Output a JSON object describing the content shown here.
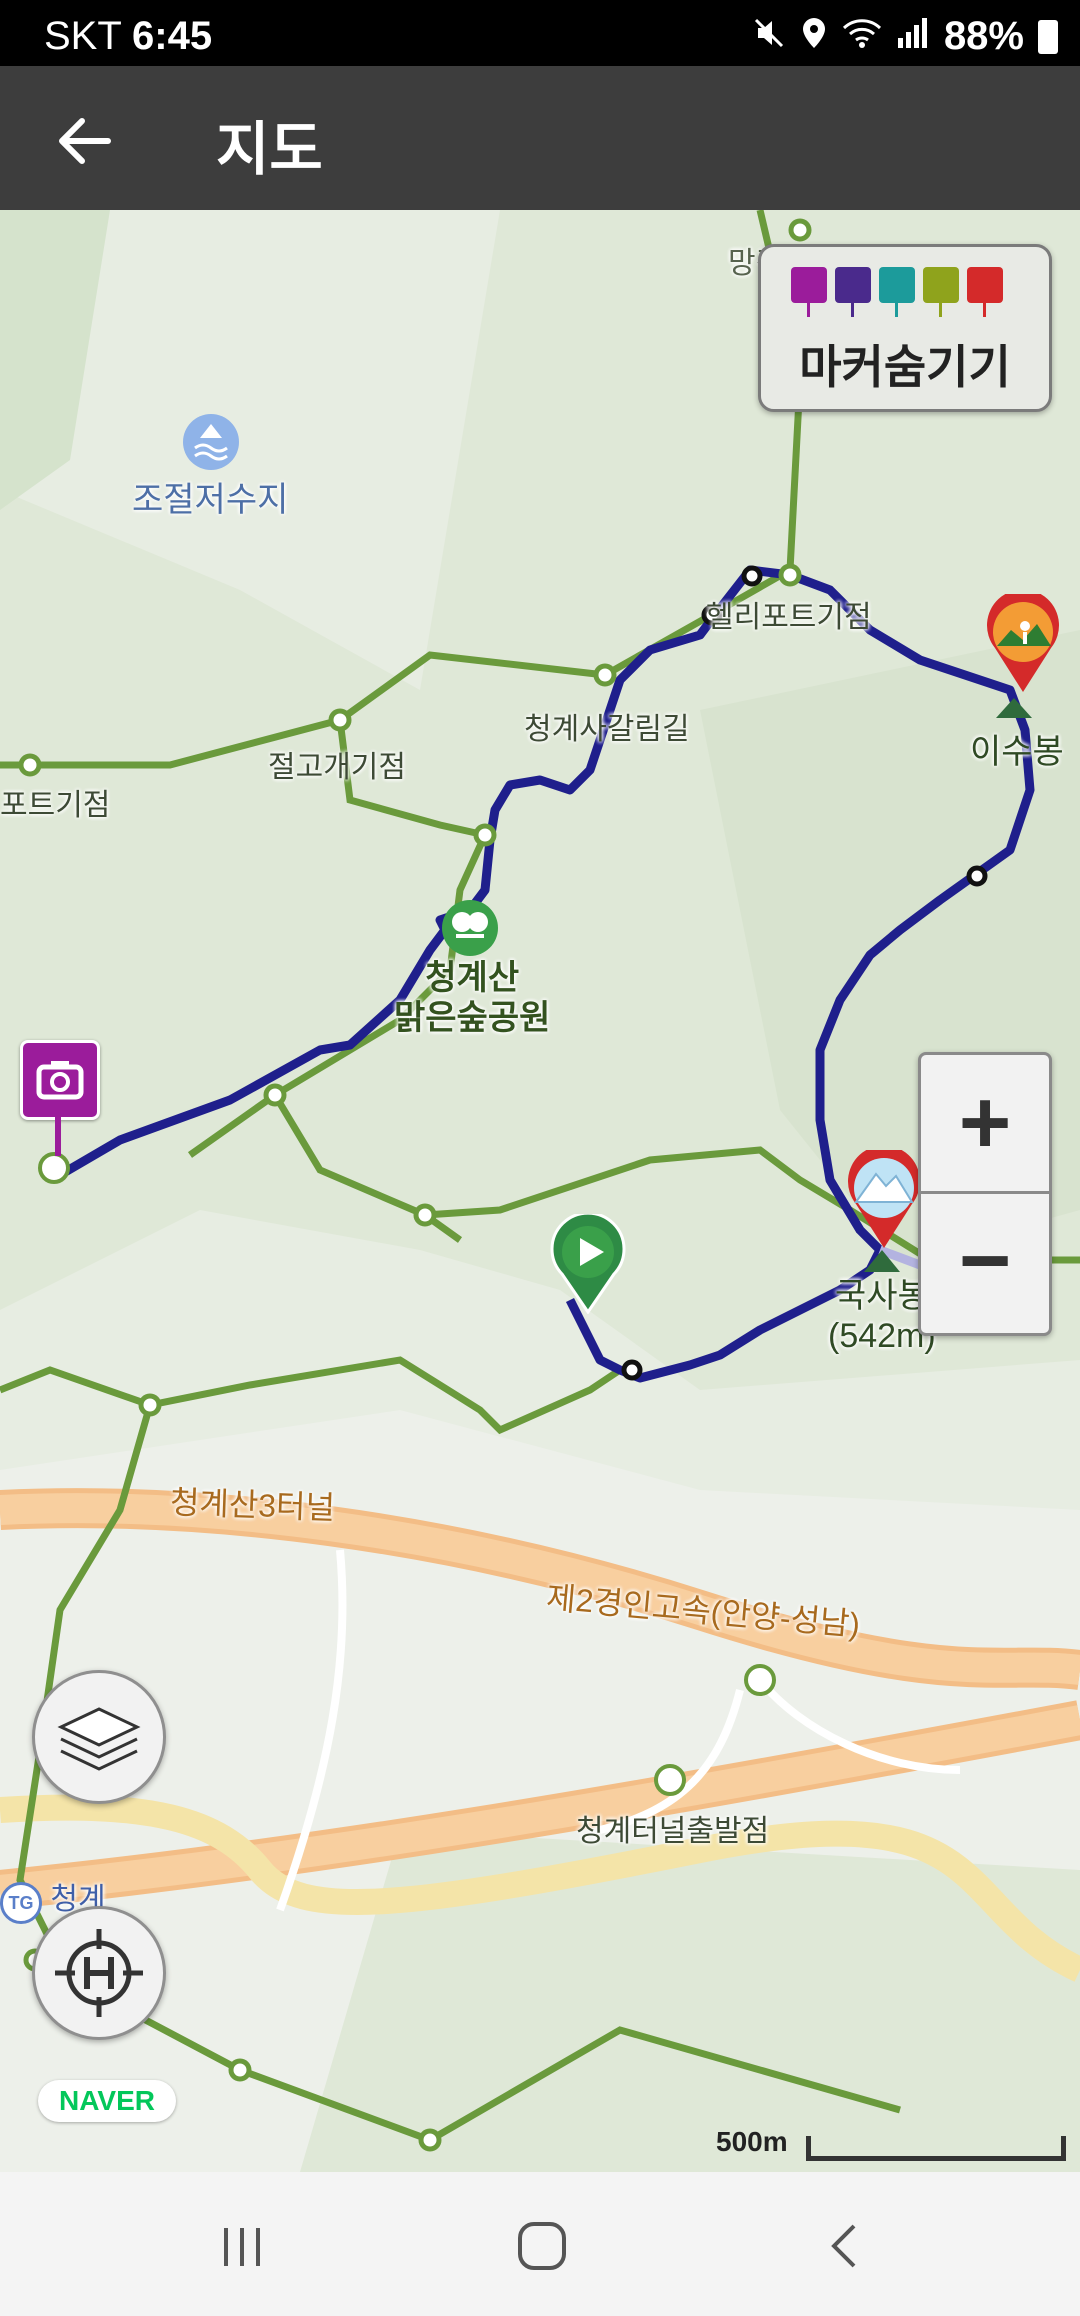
{
  "status_bar": {
    "carrier": "SKT",
    "time": "6:45",
    "battery": "88%"
  },
  "app_bar": {
    "title": "지도",
    "back_icon": "arrow-left-icon"
  },
  "marker_panel": {
    "label": "마커숨기기",
    "icons": [
      {
        "name": "camera-marker-icon",
        "color": "#9b1c9b"
      },
      {
        "name": "video-marker-icon",
        "color": "#4a2a8c"
      },
      {
        "name": "voice-marker-icon",
        "color": "#1c9b9b"
      },
      {
        "name": "memo-marker-icon",
        "color": "#8fa31c"
      },
      {
        "name": "flag-marker-icon",
        "color": "#d42a2a"
      }
    ]
  },
  "map_labels": {
    "reservoir": "조절저수지",
    "heliport_n": "헬리포트기점",
    "heliport_w": "포트기점",
    "temple_road": "청계사갈림길",
    "pass": "절고개기점",
    "park": "청계산\n맑은숲공원",
    "peak_isu": "이수봉",
    "peak_guksa": "국사봉\n(542m)",
    "tunnel": "청계산3터널",
    "highway": "제2경인고속(안양-성남)",
    "tunnel_exit": "청계터널출발점",
    "tg": "청계",
    "top_partial": "망경대기점"
  },
  "map_controls": {
    "zoom_in": "+",
    "zoom_out": "−",
    "layers_icon": "layers-icon",
    "locate_icon": "locate-heading-icon",
    "naver": "NAVER",
    "scale": "500m"
  },
  "colors": {
    "route": "#1f1f8c",
    "trail": "#6a9a3c",
    "highway": "#f5c48f",
    "start": "#2e8b45"
  }
}
